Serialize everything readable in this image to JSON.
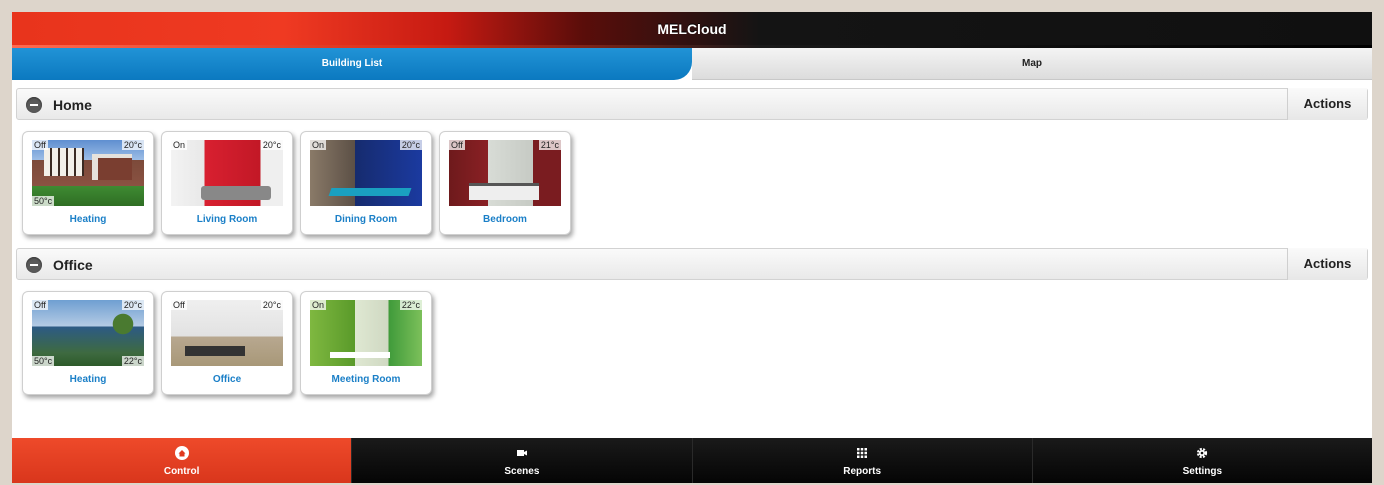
{
  "app": {
    "title": "MELCloud"
  },
  "tabs": [
    {
      "label": "Building List",
      "active": true
    },
    {
      "label": "Map",
      "active": false
    }
  ],
  "groups": [
    {
      "name": "Home",
      "actions_label": "Actions",
      "devices": [
        {
          "name": "Heating",
          "state": "Off",
          "temp": "20°c",
          "extra": "50°c",
          "extra2": "",
          "scene": "house"
        },
        {
          "name": "Living Room",
          "state": "On",
          "temp": "20°c",
          "extra": "",
          "extra2": "",
          "scene": "living"
        },
        {
          "name": "Dining Room",
          "state": "On",
          "temp": "20°c",
          "extra": "",
          "extra2": "",
          "scene": "dining"
        },
        {
          "name": "Bedroom",
          "state": "Off",
          "temp": "21°c",
          "extra": "",
          "extra2": "",
          "scene": "bedroom"
        }
      ]
    },
    {
      "name": "Office",
      "actions_label": "Actions",
      "devices": [
        {
          "name": "Heating",
          "state": "Off",
          "temp": "20°c",
          "extra": "50°c",
          "extra2": "22°c",
          "scene": "officebld"
        },
        {
          "name": "Office",
          "state": "Off",
          "temp": "20°c",
          "extra": "",
          "extra2": "",
          "scene": "officeroom"
        },
        {
          "name": "Meeting Room",
          "state": "On",
          "temp": "22°c",
          "extra": "",
          "extra2": "",
          "scene": "meeting"
        }
      ]
    }
  ],
  "bottom_nav": [
    {
      "label": "Control",
      "icon": "home-icon",
      "active": true
    },
    {
      "label": "Scenes",
      "icon": "video-camera-icon",
      "active": false
    },
    {
      "label": "Reports",
      "icon": "grid-icon",
      "active": false
    },
    {
      "label": "Settings",
      "icon": "gear-icon",
      "active": false
    }
  ],
  "colors": {
    "accent_red": "#e8341c",
    "accent_blue": "#0b79c0",
    "link_blue": "#1a7fc7"
  }
}
